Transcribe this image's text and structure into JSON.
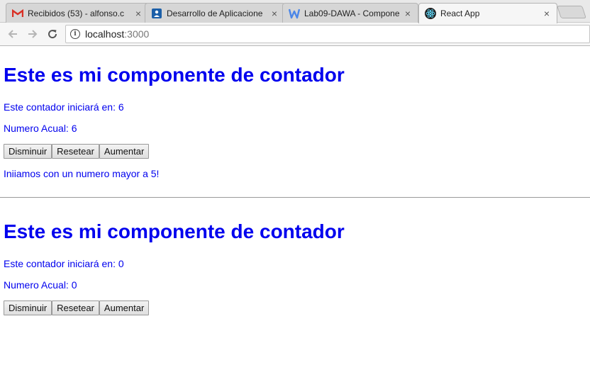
{
  "browser": {
    "tabs": [
      {
        "title": "Recibidos (53) - alfonso.c",
        "icon": "gmail-icon",
        "active": false
      },
      {
        "title": "Desarrollo de Aplicacione",
        "icon": "classroom-icon",
        "active": false
      },
      {
        "title": "Lab09-DAWA - Compone",
        "icon": "word-icon",
        "active": false
      },
      {
        "title": "React App",
        "icon": "react-icon",
        "active": true
      }
    ],
    "close_glyph": "×",
    "url_host": "localhost",
    "url_port": ":3000"
  },
  "counters": [
    {
      "heading": "Este es mi componente de contador",
      "start_text": "Este contador iniciará en: 6",
      "current_text": "Numero Acual: 6",
      "buttons": {
        "decrease": "Disminuir",
        "reset": "Resetear",
        "increase": "Aumentar"
      },
      "message": "Iniiamos con un numero mayor a 5!"
    },
    {
      "heading": "Este es mi componente de contador",
      "start_text": "Este contador iniciará en: 0",
      "current_text": "Numero Acual: 0",
      "buttons": {
        "decrease": "Disminuir",
        "reset": "Resetear",
        "increase": "Aumentar"
      }
    }
  ],
  "colors": {
    "text_blue": "#0000ee",
    "gmail_red": "#d93025",
    "word_blue": "#4a86e8",
    "react_cyan": "#61dafb"
  }
}
